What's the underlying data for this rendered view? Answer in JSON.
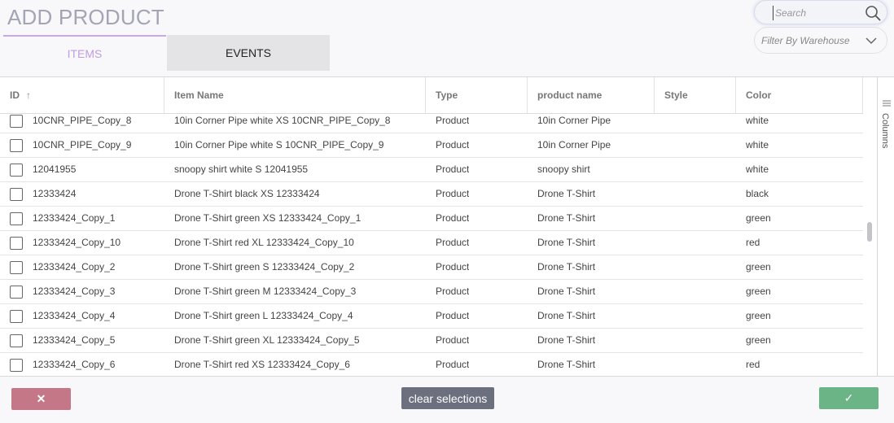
{
  "page": {
    "title": "ADD PRODUCT"
  },
  "tabs": [
    {
      "label": "ITEMS",
      "active": true
    },
    {
      "label": "EVENTS",
      "active": false
    }
  ],
  "search": {
    "placeholder": "Search",
    "value": ""
  },
  "filter": {
    "placeholder": "Filter By Warehouse"
  },
  "table": {
    "columns": [
      "ID",
      "Item Name",
      "Type",
      "product name",
      "Style",
      "Color"
    ],
    "sorted_column": "ID",
    "sort_direction": "ascending",
    "rows": [
      {
        "id": "10CNR_PIPE_Copy_8",
        "item_name": "10in Corner Pipe white XS 10CNR_PIPE_Copy_8",
        "type": "Product",
        "product_name": "10in Corner Pipe",
        "style": "",
        "color": "white"
      },
      {
        "id": "10CNR_PIPE_Copy_9",
        "item_name": "10in Corner Pipe white S 10CNR_PIPE_Copy_9",
        "type": "Product",
        "product_name": "10in Corner Pipe",
        "style": "",
        "color": "white"
      },
      {
        "id": "12041955",
        "item_name": "snoopy shirt white S 12041955",
        "type": "Product",
        "product_name": "snoopy shirt",
        "style": "",
        "color": "white"
      },
      {
        "id": "12333424",
        "item_name": "Drone T-Shirt black XS 12333424",
        "type": "Product",
        "product_name": "Drone T-Shirt",
        "style": "",
        "color": "black"
      },
      {
        "id": "12333424_Copy_1",
        "item_name": "Drone T-Shirt green XS 12333424_Copy_1",
        "type": "Product",
        "product_name": "Drone T-Shirt",
        "style": "",
        "color": "green"
      },
      {
        "id": "12333424_Copy_10",
        "item_name": "Drone T-Shirt red XL 12333424_Copy_10",
        "type": "Product",
        "product_name": "Drone T-Shirt",
        "style": "",
        "color": "red"
      },
      {
        "id": "12333424_Copy_2",
        "item_name": "Drone T-Shirt green S 12333424_Copy_2",
        "type": "Product",
        "product_name": "Drone T-Shirt",
        "style": "",
        "color": "green"
      },
      {
        "id": "12333424_Copy_3",
        "item_name": "Drone T-Shirt green M 12333424_Copy_3",
        "type": "Product",
        "product_name": "Drone T-Shirt",
        "style": "",
        "color": "green"
      },
      {
        "id": "12333424_Copy_4",
        "item_name": "Drone T-Shirt green L 12333424_Copy_4",
        "type": "Product",
        "product_name": "Drone T-Shirt",
        "style": "",
        "color": "green"
      },
      {
        "id": "12333424_Copy_5",
        "item_name": "Drone T-Shirt green XL 12333424_Copy_5",
        "type": "Product",
        "product_name": "Drone T-Shirt",
        "style": "",
        "color": "green"
      },
      {
        "id": "12333424_Copy_6",
        "item_name": "Drone T-Shirt red XS 12333424_Copy_6",
        "type": "Product",
        "product_name": "Drone T-Shirt",
        "style": "",
        "color": "red"
      }
    ]
  },
  "side_panel": {
    "columns_label": "Columns"
  },
  "footer": {
    "cancel_symbol": "✕",
    "clear_label": "clear selections",
    "confirm_symbol": "✓"
  },
  "icons": {
    "search": "search-icon",
    "filter_dropdown": "chevron-down-icon",
    "sort": "arrow-up-icon",
    "columns": "columns-icon",
    "cancel": "close-icon",
    "confirm": "check-icon"
  },
  "colors": {
    "title": "#a4a4b4",
    "active_tab": "#c29be6",
    "cancel_button": "#c47786",
    "clear_button": "#6c6f7e",
    "confirm_button": "#6ab485"
  }
}
